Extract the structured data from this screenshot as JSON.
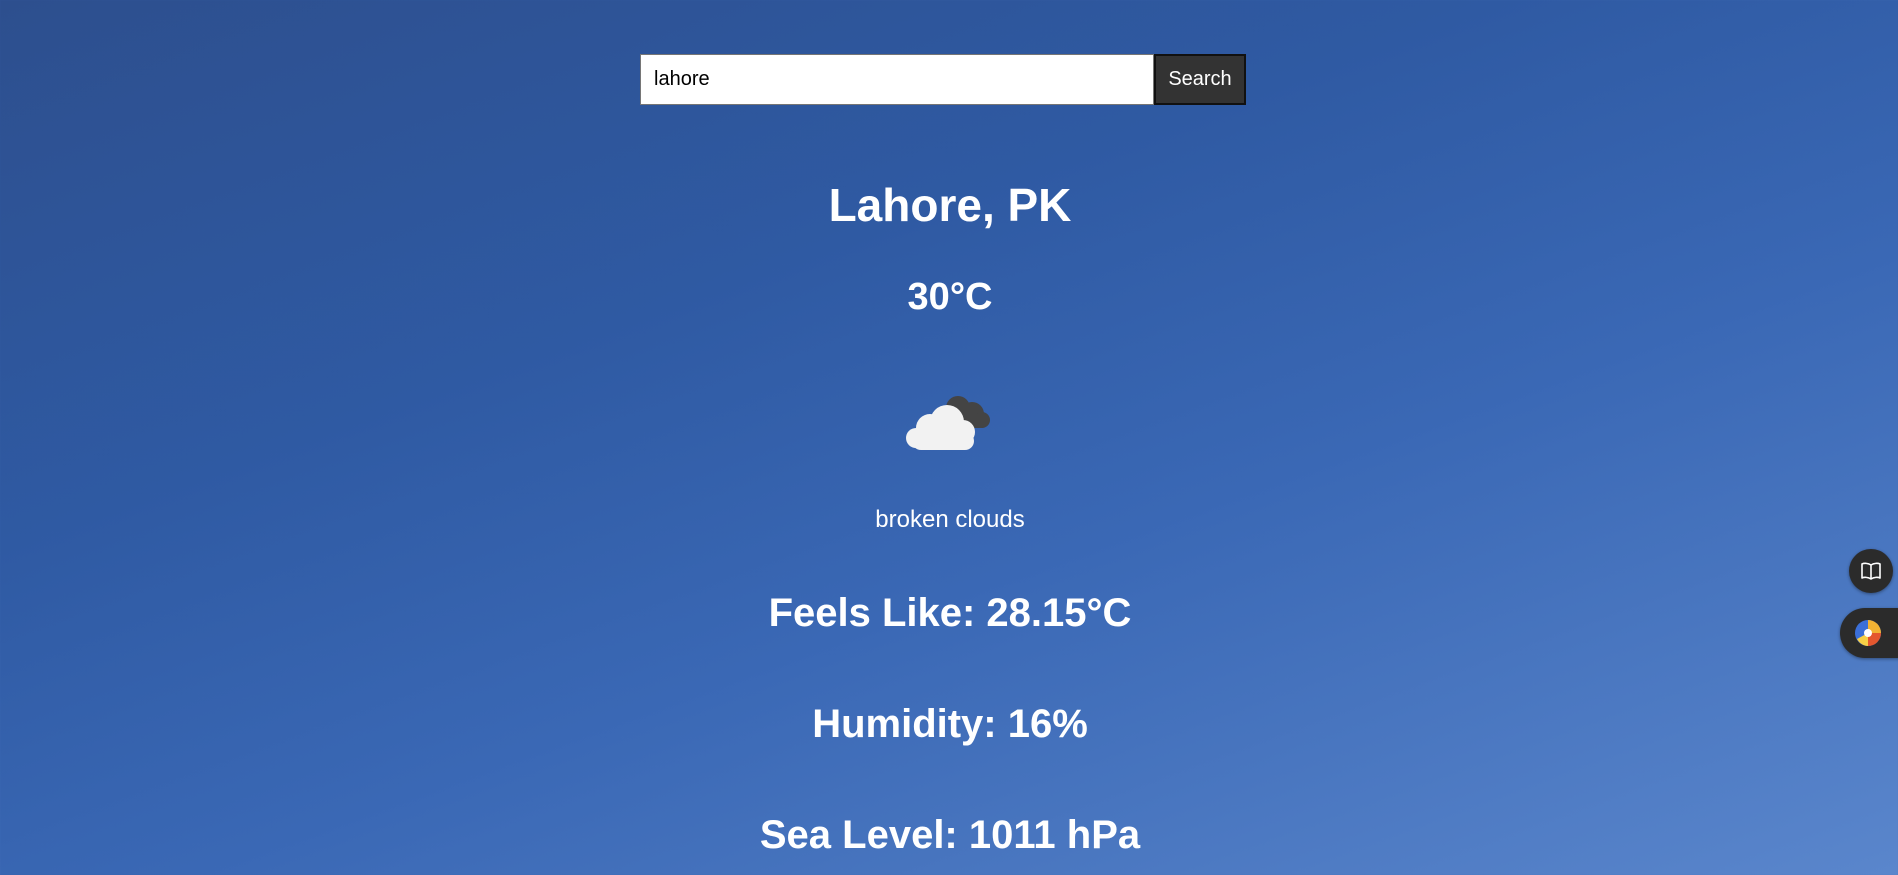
{
  "search": {
    "value": "lahore",
    "button_label": "Search"
  },
  "weather": {
    "city": "Lahore, PK",
    "temperature": "30°C",
    "icon": "broken-clouds-icon",
    "description": "broken clouds",
    "feels_like": "Feels Like: 28.15°C",
    "humidity": "Humidity: 16%",
    "sea_level": "Sea Level: 1011 hPa"
  },
  "side_buttons": {
    "reader_icon": "book-icon",
    "extension_icon": "extension-logo-icon"
  },
  "colors": {
    "background": "#2f5aa3",
    "button": "#333333",
    "text": "#ffffff"
  }
}
